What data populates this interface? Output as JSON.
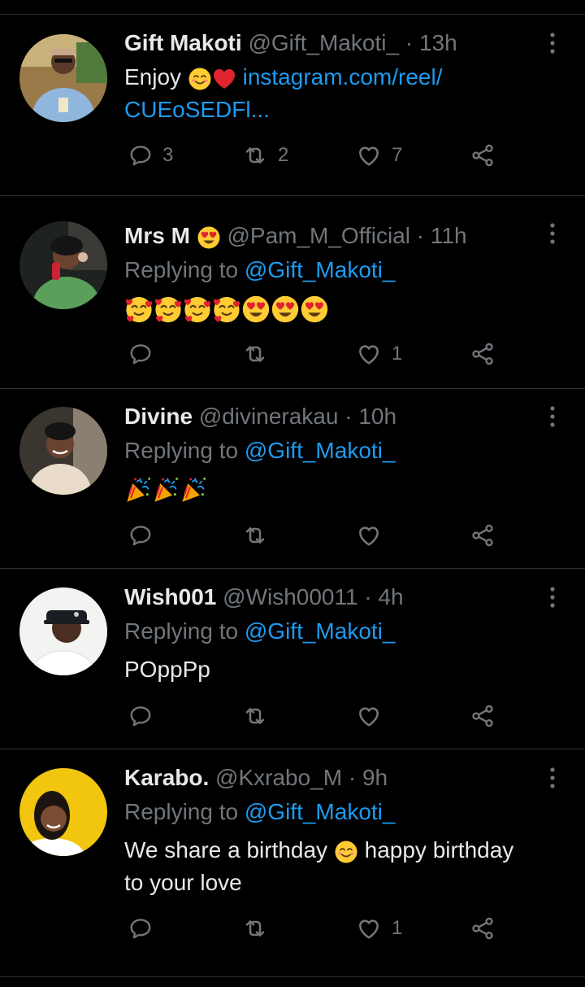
{
  "tweets": [
    {
      "name": "Gift Makoti",
      "handle": "@Gift_Makoti_",
      "time": "· 13h",
      "text_prefix": "Enjoy",
      "link_line1": "instagram.com/reel/",
      "link_line2": "CUEoSEDFl...",
      "replies": "3",
      "retweets": "2",
      "likes": "7",
      "avatar_bg": "#8a6a3c"
    },
    {
      "name": "Mrs M",
      "handle": "@Pam_M_Official",
      "time": "· 11h",
      "replying_label": "Replying to",
      "replying_to": "@Gift_Makoti_",
      "replies": "",
      "retweets": "",
      "likes": "1",
      "avatar_bg": "#2b2f2a"
    },
    {
      "name": "Divine",
      "handle": "@divinerakau",
      "time": "· 10h",
      "replying_label": "Replying to",
      "replying_to": "@Gift_Makoti_",
      "replies": "",
      "retweets": "",
      "likes": "",
      "avatar_bg": "#3a342e"
    },
    {
      "name": "Wish001",
      "handle": "@Wish00011",
      "time": "· 4h",
      "replying_label": "Replying to",
      "replying_to": "@Gift_Makoti_",
      "text": "POppPp",
      "replies": "",
      "retweets": "",
      "likes": "",
      "avatar_bg": "#f2f2f2"
    },
    {
      "name": "Karabo.",
      "handle": "@Kxrabo_M",
      "time": "· 9h",
      "replying_label": "Replying to",
      "replying_to": "@Gift_Makoti_",
      "text_line1_a": "We share a birthday",
      "text_line1_b": "happy birthday",
      "text_line2": "to your love",
      "replies": "",
      "retweets": "",
      "likes": "1",
      "avatar_bg": "#f5c518"
    }
  ],
  "colors": {
    "background": "#000000",
    "primary_text": "#e7e9ea",
    "secondary_text": "#71767b",
    "link": "#1d9bf0",
    "divider": "#2f3336"
  },
  "icons": [
    "reply-icon",
    "retweet-icon",
    "like-icon",
    "share-icon",
    "more-icon"
  ]
}
